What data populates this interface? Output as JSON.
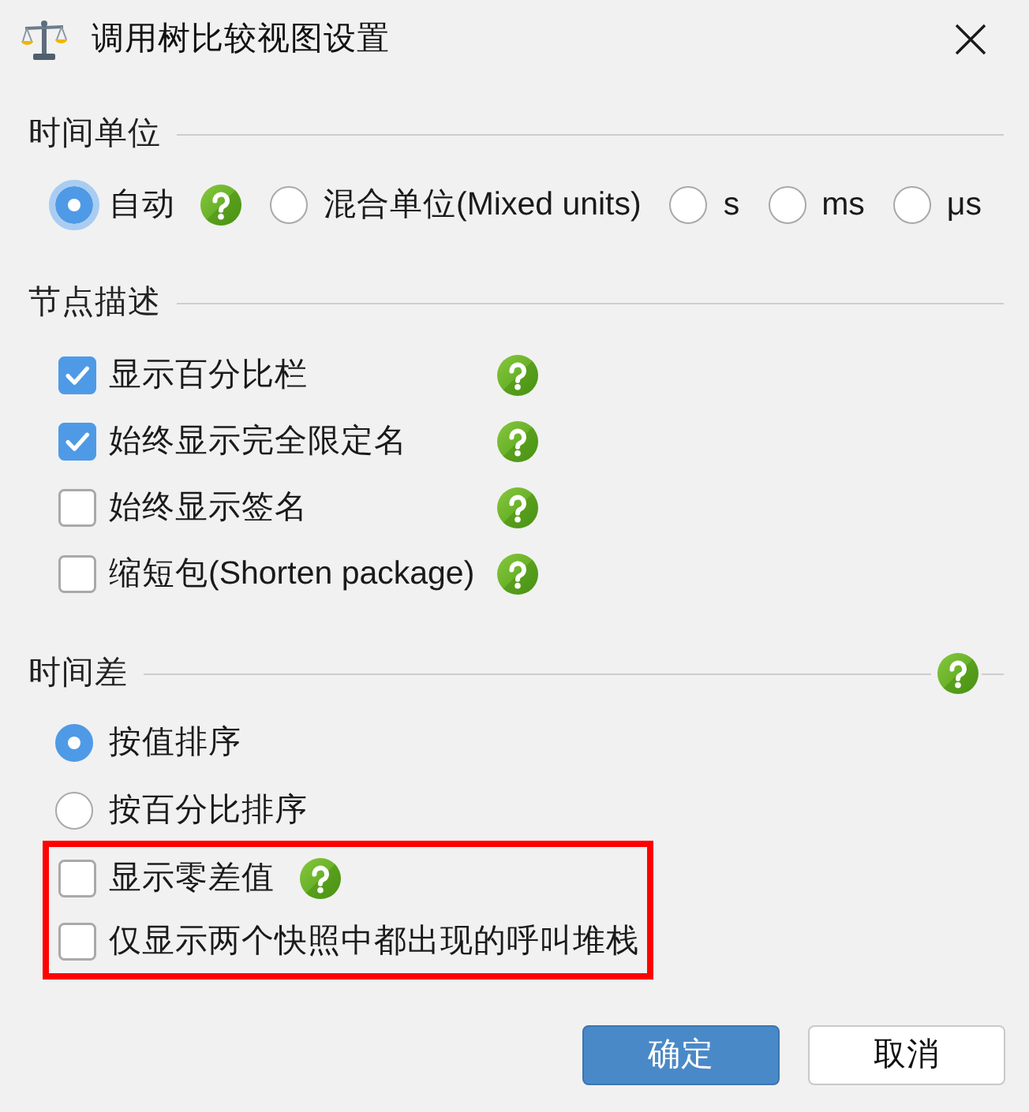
{
  "window": {
    "title": "调用树比较视图设置"
  },
  "sections": [
    {
      "title": "时间单位",
      "kind": "radio-row",
      "help": false,
      "items": [
        {
          "kind": "radio",
          "label": "自动",
          "selected": true,
          "focused": true,
          "help": true
        },
        {
          "kind": "radio",
          "label": "混合单位(Mixed units)",
          "selected": false,
          "focused": false,
          "help": false
        },
        {
          "kind": "radio",
          "label": "s",
          "selected": false,
          "focused": false,
          "help": false
        },
        {
          "kind": "radio",
          "label": "ms",
          "selected": false,
          "focused": false,
          "help": false
        },
        {
          "kind": "radio",
          "label": "μs",
          "selected": false,
          "focused": false,
          "help": false
        }
      ]
    },
    {
      "title": "节点描述",
      "kind": "aligned-list",
      "help": false,
      "items": [
        {
          "kind": "checkbox",
          "label": "显示百分比栏",
          "checked": true,
          "help": true
        },
        {
          "kind": "checkbox",
          "label": "始终显示完全限定名",
          "checked": true,
          "help": true
        },
        {
          "kind": "checkbox",
          "label": "始终显示签名",
          "checked": false,
          "help": true
        },
        {
          "kind": "checkbox",
          "label": "缩短包(Shorten package)",
          "checked": false,
          "help": true
        }
      ]
    },
    {
      "title": "时间差",
      "kind": "plain-list",
      "help": true,
      "items": [
        {
          "kind": "radio",
          "label": "按值排序",
          "selected": true,
          "help": false,
          "highlighted": false
        },
        {
          "kind": "radio",
          "label": "按百分比排序",
          "selected": false,
          "help": false,
          "highlighted": false
        },
        {
          "kind": "checkbox",
          "label": "显示零差值",
          "checked": false,
          "help": true,
          "highlighted": true
        },
        {
          "kind": "checkbox",
          "label": "仅显示两个快照中都出现的呼叫堆栈",
          "checked": false,
          "help": false,
          "highlighted": true
        }
      ]
    }
  ],
  "buttons": [
    {
      "label": "确定",
      "primary": true
    },
    {
      "label": "取消",
      "primary": false
    }
  ]
}
